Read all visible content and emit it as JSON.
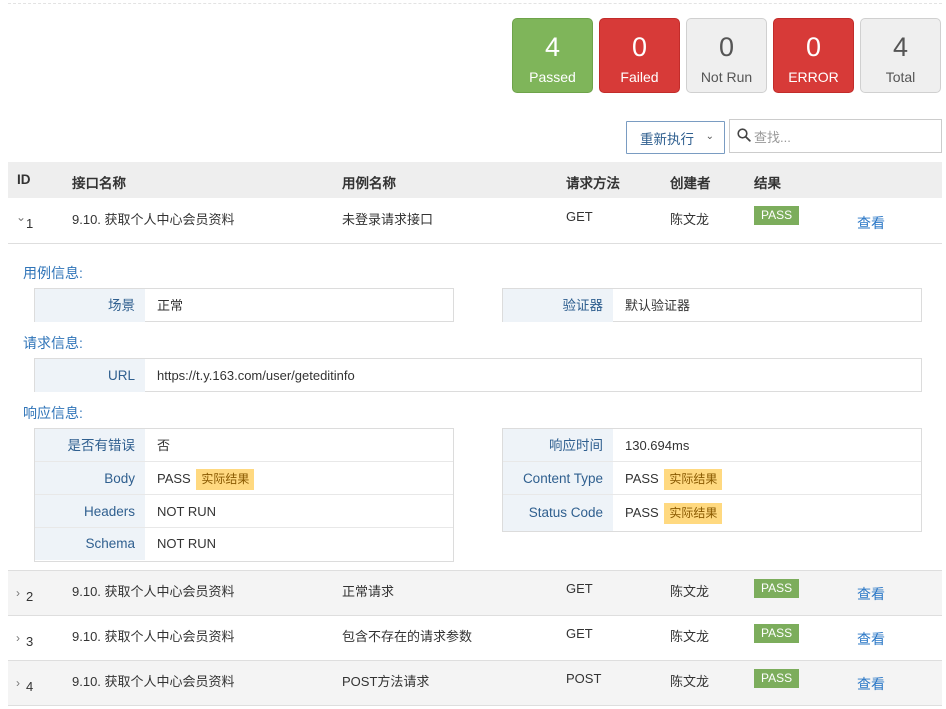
{
  "stats": [
    {
      "value": "4",
      "label": "Passed",
      "variant": "green"
    },
    {
      "value": "0",
      "label": "Failed",
      "variant": "red"
    },
    {
      "value": "0",
      "label": "Not Run",
      "variant": "gray"
    },
    {
      "value": "0",
      "label": "ERROR",
      "variant": "red"
    },
    {
      "value": "4",
      "label": "Total",
      "variant": "gray"
    }
  ],
  "toolbar": {
    "rerun_label": "重新执行",
    "search_placeholder": "查找..."
  },
  "table": {
    "headers": {
      "id": "ID",
      "api_name": "接口名称",
      "case_name": "用例名称",
      "method": "请求方法",
      "creator": "创建者",
      "result": "结果"
    },
    "rows": [
      {
        "id": "1",
        "api_name": "9.10. 获取个人中心会员资料",
        "case_name": "未登录请求接口",
        "method": "GET",
        "creator": "陈文龙",
        "result": "PASS",
        "view": "查看",
        "expanded": true
      },
      {
        "id": "2",
        "api_name": "9.10. 获取个人中心会员资料",
        "case_name": "正常请求",
        "method": "GET",
        "creator": "陈文龙",
        "result": "PASS",
        "view": "查看",
        "expanded": false
      },
      {
        "id": "3",
        "api_name": "9.10. 获取个人中心会员资料",
        "case_name": "包含不存在的请求参数",
        "method": "GET",
        "creator": "陈文龙",
        "result": "PASS",
        "view": "查看",
        "expanded": false
      },
      {
        "id": "4",
        "api_name": "9.10. 获取个人中心会员资料",
        "case_name": "POST方法请求",
        "method": "POST",
        "creator": "陈文龙",
        "result": "PASS",
        "view": "查看",
        "expanded": false
      }
    ]
  },
  "details": {
    "case_info_title": "用例信息:",
    "scene_key": "场景",
    "scene_value": "正常",
    "validator_key": "验证器",
    "validator_value": "默认验证器",
    "request_info_title": "请求信息:",
    "url_key": "URL",
    "url_value": "https://t.y.163.com/user/geteditinfo",
    "response_info_title": "响应信息:",
    "left": [
      {
        "key": "是否有错误",
        "value": "否",
        "tag": ""
      },
      {
        "key": "Body",
        "value": "PASS",
        "tag": "实际结果"
      },
      {
        "key": "Headers",
        "value": "NOT RUN",
        "tag": ""
      },
      {
        "key": "Schema",
        "value": "NOT RUN",
        "tag": ""
      }
    ],
    "right": [
      {
        "key": "响应时间",
        "value": "130.694ms",
        "tag": ""
      },
      {
        "key": "Content Type",
        "value": "PASS",
        "tag": "实际结果"
      },
      {
        "key": "Status Code",
        "value": "PASS",
        "tag": "实际结果"
      }
    ]
  },
  "colors": {
    "passed": "#7fb55a",
    "failed": "#d73a38",
    "neutral": "#efefef",
    "link": "#2a77c6",
    "label": "#2f74b8"
  }
}
